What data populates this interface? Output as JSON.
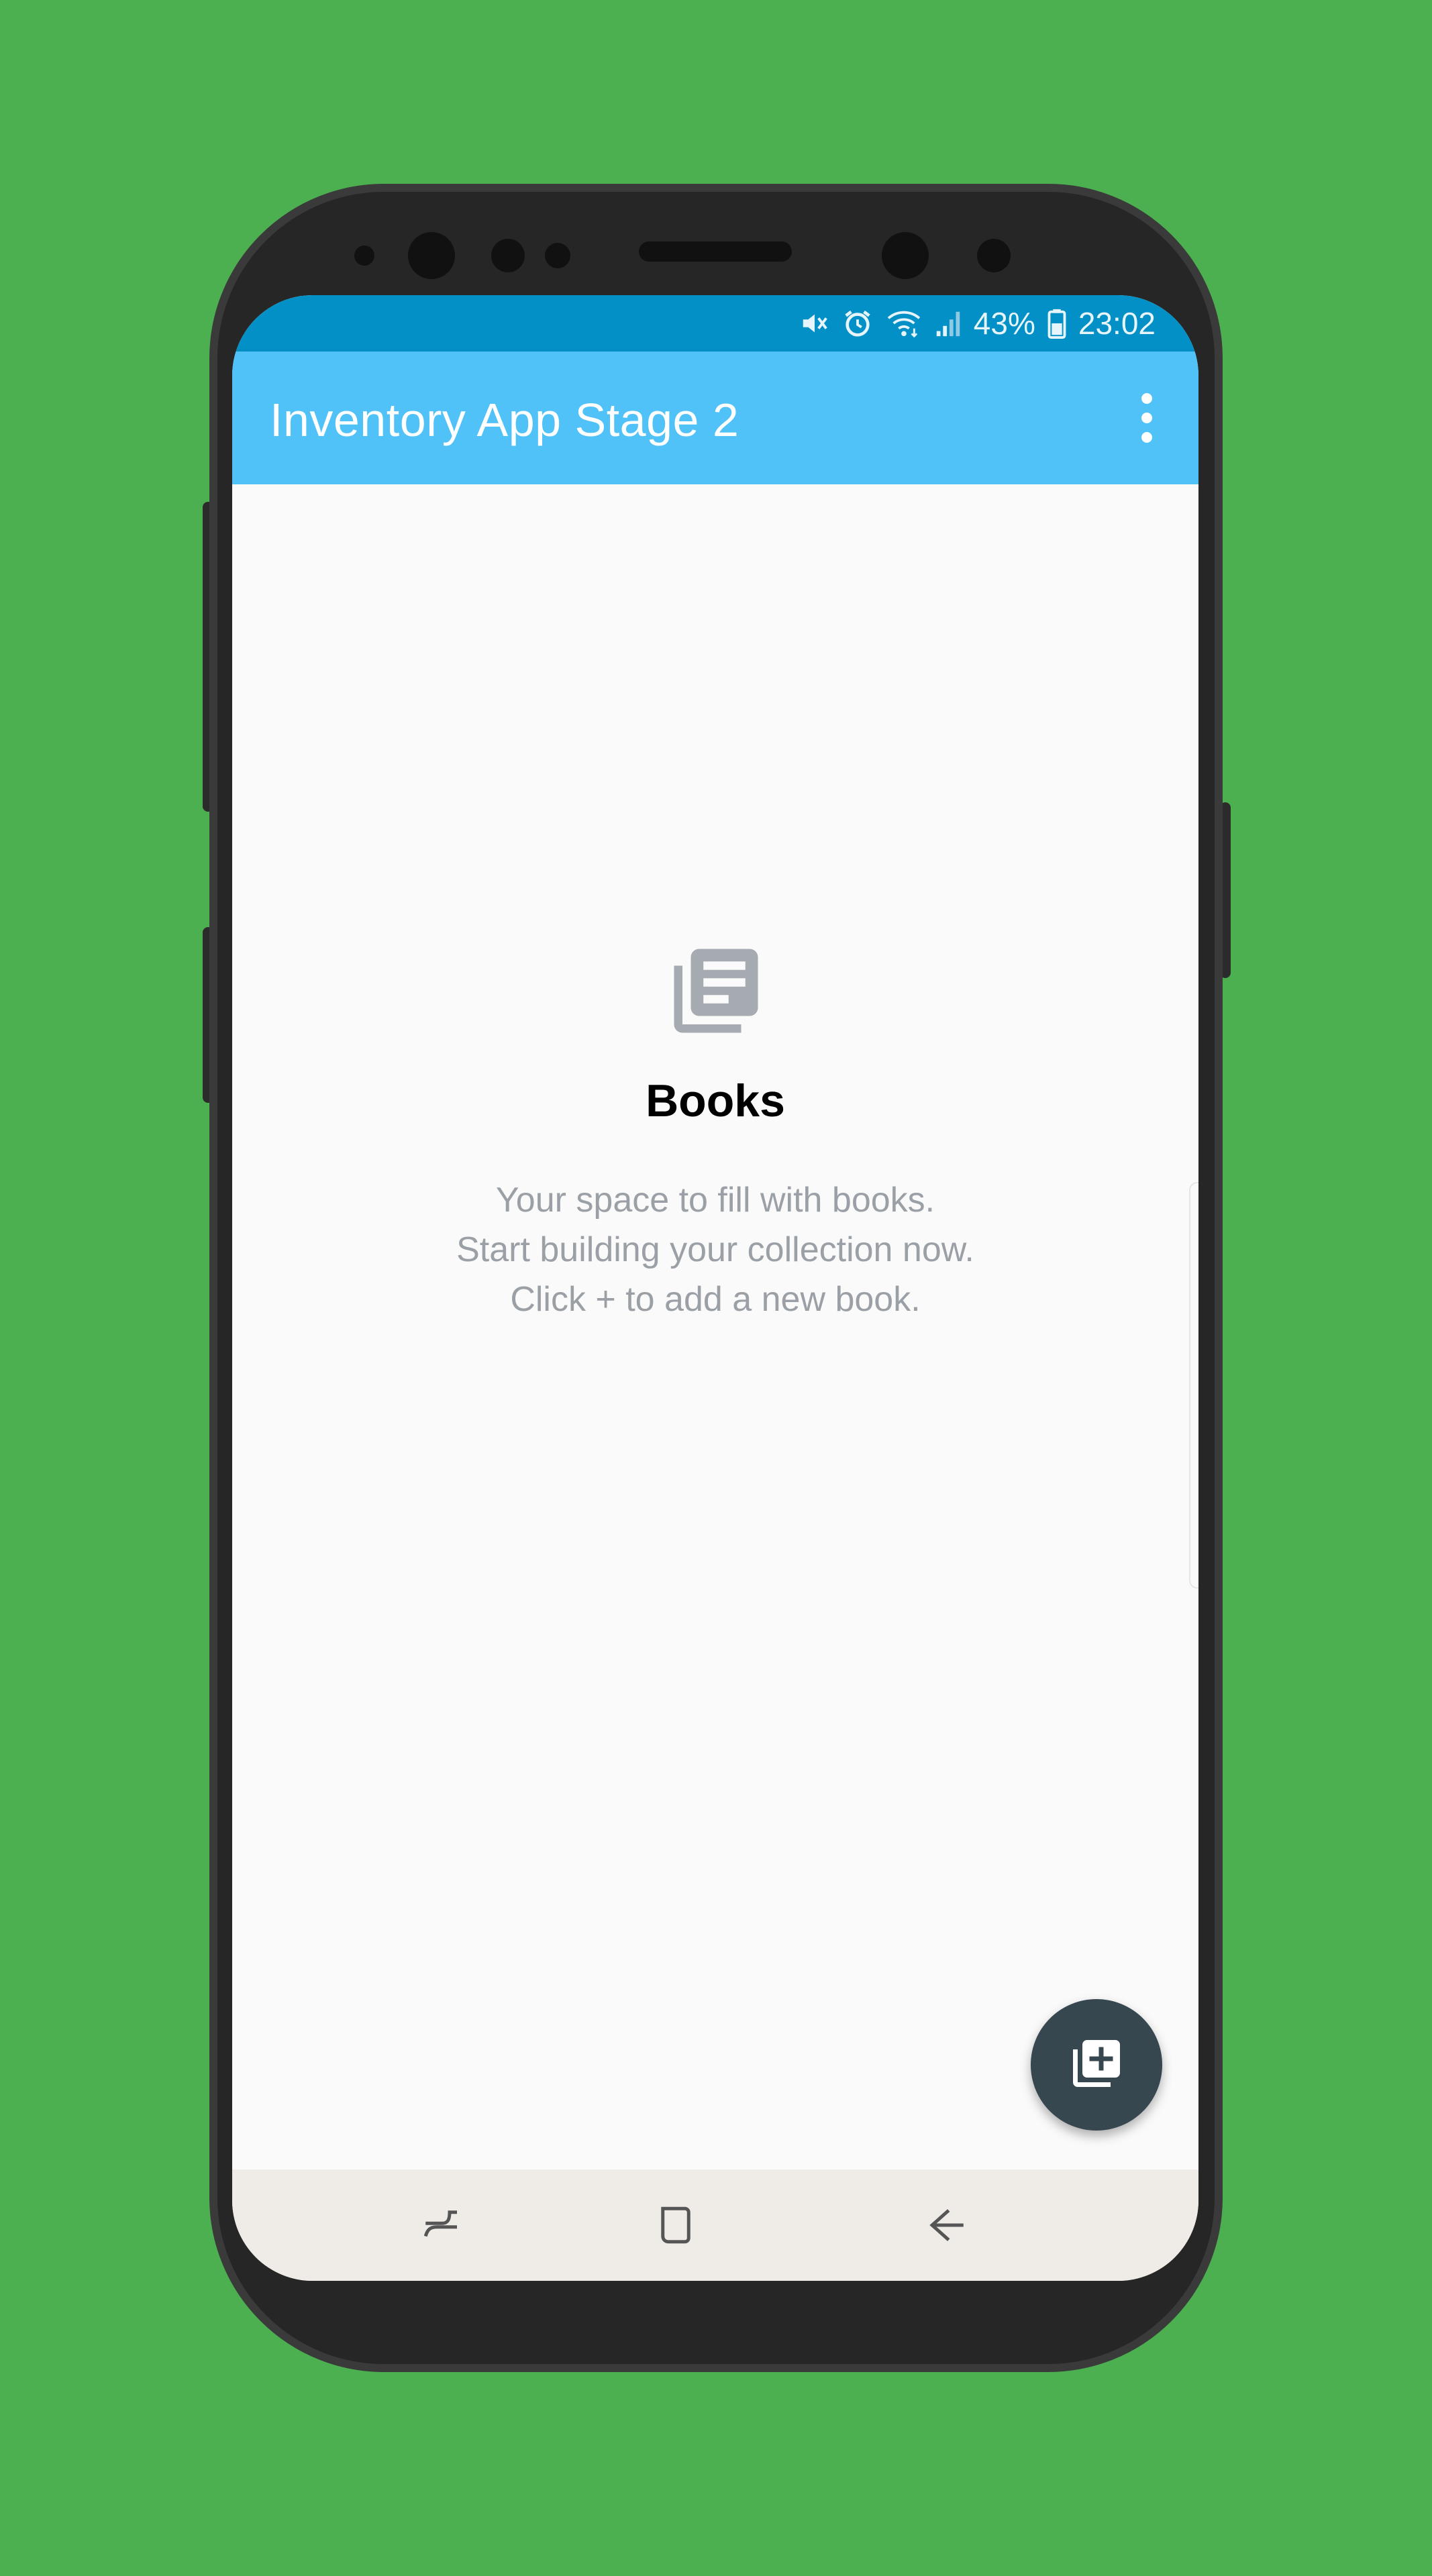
{
  "status_bar": {
    "battery_percent": "43%",
    "time": "23:02",
    "icons": [
      "mute-icon",
      "alarm-icon",
      "wifi-icon",
      "signal-icon",
      "battery-icon"
    ]
  },
  "app_bar": {
    "title": "Inventory App Stage 2",
    "menu_icon": "overflow-menu-icon"
  },
  "empty_state": {
    "icon": "library-books-icon",
    "title": "Books",
    "lines": [
      "Your space to fill with books.",
      "Start building your collection now.",
      "Click + to add a new book."
    ]
  },
  "fab": {
    "icon": "library-add-icon"
  },
  "navigation_bar": {
    "buttons": [
      "recents-icon",
      "home-icon",
      "back-icon"
    ]
  },
  "colors": {
    "background": "#4caf50",
    "status_bar": "#0390c6",
    "app_bar": "#50c2f8",
    "fab": "#37474f",
    "screen": "#fafafa",
    "nav_bar": "#efebe7"
  }
}
